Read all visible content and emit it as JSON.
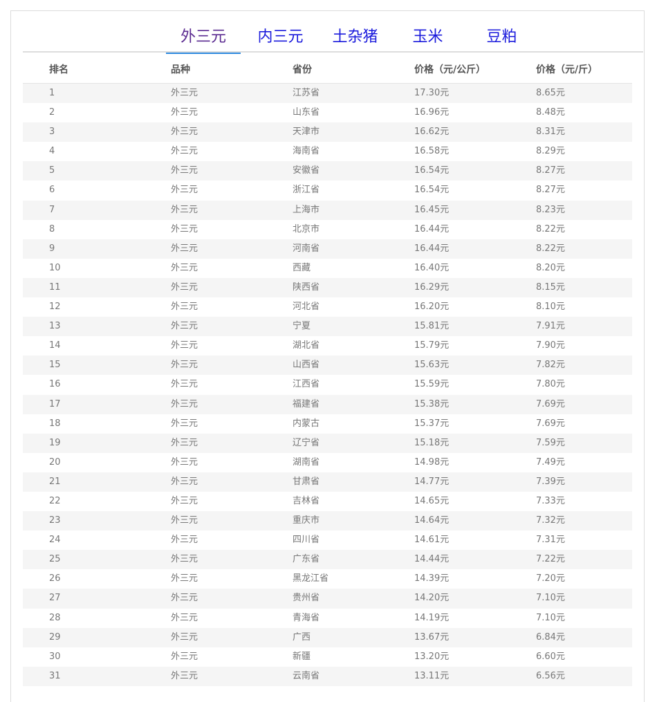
{
  "tabs": [
    {
      "label": "外三元",
      "active": true
    },
    {
      "label": "内三元",
      "active": false
    },
    {
      "label": "土杂猪",
      "active": false
    },
    {
      "label": "玉米",
      "active": false
    },
    {
      "label": "豆粕",
      "active": false
    }
  ],
  "table": {
    "headers": [
      "排名",
      "品种",
      "省份",
      "价格（元/公斤）",
      "价格（元/斤）"
    ],
    "rows": [
      [
        "1",
        "外三元",
        "江苏省",
        "17.30元",
        "8.65元"
      ],
      [
        "2",
        "外三元",
        "山东省",
        "16.96元",
        "8.48元"
      ],
      [
        "3",
        "外三元",
        "天津市",
        "16.62元",
        "8.31元"
      ],
      [
        "4",
        "外三元",
        "海南省",
        "16.58元",
        "8.29元"
      ],
      [
        "5",
        "外三元",
        "安徽省",
        "16.54元",
        "8.27元"
      ],
      [
        "6",
        "外三元",
        "浙江省",
        "16.54元",
        "8.27元"
      ],
      [
        "7",
        "外三元",
        "上海市",
        "16.45元",
        "8.23元"
      ],
      [
        "8",
        "外三元",
        "北京市",
        "16.44元",
        "8.22元"
      ],
      [
        "9",
        "外三元",
        "河南省",
        "16.44元",
        "8.22元"
      ],
      [
        "10",
        "外三元",
        "西藏",
        "16.40元",
        "8.20元"
      ],
      [
        "11",
        "外三元",
        "陕西省",
        "16.29元",
        "8.15元"
      ],
      [
        "12",
        "外三元",
        "河北省",
        "16.20元",
        "8.10元"
      ],
      [
        "13",
        "外三元",
        "宁夏",
        "15.81元",
        "7.91元"
      ],
      [
        "14",
        "外三元",
        "湖北省",
        "15.79元",
        "7.90元"
      ],
      [
        "15",
        "外三元",
        "山西省",
        "15.63元",
        "7.82元"
      ],
      [
        "16",
        "外三元",
        "江西省",
        "15.59元",
        "7.80元"
      ],
      [
        "17",
        "外三元",
        "福建省",
        "15.38元",
        "7.69元"
      ],
      [
        "18",
        "外三元",
        "内蒙古",
        "15.37元",
        "7.69元"
      ],
      [
        "19",
        "外三元",
        "辽宁省",
        "15.18元",
        "7.59元"
      ],
      [
        "20",
        "外三元",
        "湖南省",
        "14.98元",
        "7.49元"
      ],
      [
        "21",
        "外三元",
        "甘肃省",
        "14.77元",
        "7.39元"
      ],
      [
        "22",
        "外三元",
        "吉林省",
        "14.65元",
        "7.33元"
      ],
      [
        "23",
        "外三元",
        "重庆市",
        "14.64元",
        "7.32元"
      ],
      [
        "24",
        "外三元",
        "四川省",
        "14.61元",
        "7.31元"
      ],
      [
        "25",
        "外三元",
        "广东省",
        "14.44元",
        "7.22元"
      ],
      [
        "26",
        "外三元",
        "黑龙江省",
        "14.39元",
        "7.20元"
      ],
      [
        "27",
        "外三元",
        "贵州省",
        "14.20元",
        "7.10元"
      ],
      [
        "28",
        "外三元",
        "青海省",
        "14.19元",
        "7.10元"
      ],
      [
        "29",
        "外三元",
        "广西",
        "13.67元",
        "6.84元"
      ],
      [
        "30",
        "外三元",
        "新疆",
        "13.20元",
        "6.60元"
      ],
      [
        "31",
        "外三元",
        "云南省",
        "13.11元",
        "6.56元"
      ]
    ]
  },
  "colors": {
    "tab_text": "#1a1adc",
    "tab_active_text": "#5a2a90",
    "tab_underline": "#2d8ae0",
    "row_stripe": "#f5f5f5"
  }
}
